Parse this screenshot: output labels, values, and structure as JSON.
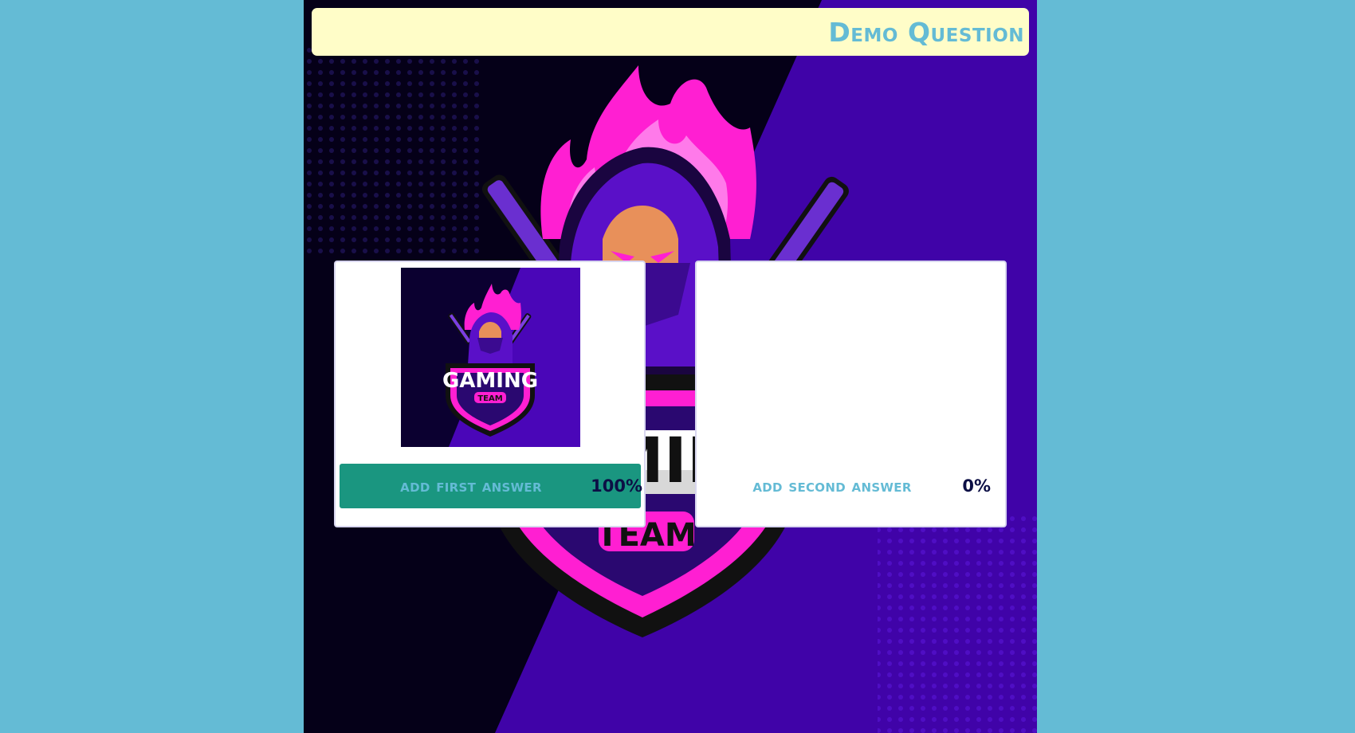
{
  "question": {
    "title": "Demo Question"
  },
  "logo": {
    "text_main": "GAMING",
    "text_sub": "TEAM"
  },
  "answers": [
    {
      "label": "add first answer",
      "percent": "100%",
      "selected": true,
      "has_image": true
    },
    {
      "label": "add second answer",
      "percent": "0%",
      "selected": false,
      "has_image": false
    }
  ],
  "colors": {
    "page_background": "#64bbd5",
    "header_background": "#fffdc8",
    "title_color": "#64bbd5",
    "selected_answer": "#1a9680",
    "percent_color": "#0c0f45",
    "logo_pink": "#ff1fd2",
    "logo_purple": "#4b06b4"
  }
}
